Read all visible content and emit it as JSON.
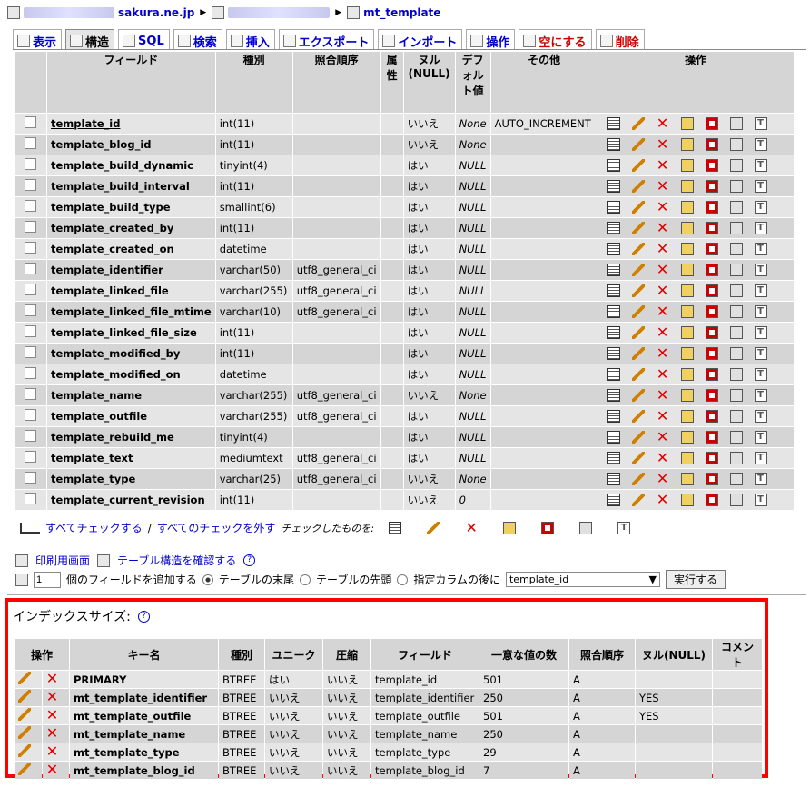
{
  "breadcrumb": {
    "server": "sakura.ne.jp",
    "table": "mt_template"
  },
  "tabs": [
    {
      "label": "表示",
      "active": false,
      "danger": false
    },
    {
      "label": "構造",
      "active": true,
      "danger": false
    },
    {
      "label": "SQL",
      "active": false,
      "danger": false
    },
    {
      "label": "検索",
      "active": false,
      "danger": false
    },
    {
      "label": "挿入",
      "active": false,
      "danger": false
    },
    {
      "label": "エクスポート",
      "active": false,
      "danger": false
    },
    {
      "label": "インポート",
      "active": false,
      "danger": false
    },
    {
      "label": "操作",
      "active": false,
      "danger": false
    },
    {
      "label": "空にする",
      "active": false,
      "danger": true
    },
    {
      "label": "削除",
      "active": false,
      "danger": true
    }
  ],
  "fields_table": {
    "headers": {
      "field": "フィールド",
      "type": "種別",
      "collation": "照合順序",
      "attr": "属性",
      "null": "ヌル (NULL)",
      "default": "デフォルト値",
      "extra": "その他",
      "action": "操作"
    },
    "rows": [
      {
        "name": "template_id",
        "type": "int(11)",
        "collation": "",
        "null": "いいえ",
        "default": "None",
        "extra": "AUTO_INCREMENT",
        "underline": true
      },
      {
        "name": "template_blog_id",
        "type": "int(11)",
        "collation": "",
        "null": "いいえ",
        "default": "None",
        "extra": ""
      },
      {
        "name": "template_build_dynamic",
        "type": "tinyint(4)",
        "collation": "",
        "null": "はい",
        "default": "NULL",
        "extra": ""
      },
      {
        "name": "template_build_interval",
        "type": "int(11)",
        "collation": "",
        "null": "はい",
        "default": "NULL",
        "extra": ""
      },
      {
        "name": "template_build_type",
        "type": "smallint(6)",
        "collation": "",
        "null": "はい",
        "default": "NULL",
        "extra": ""
      },
      {
        "name": "template_created_by",
        "type": "int(11)",
        "collation": "",
        "null": "はい",
        "default": "NULL",
        "extra": ""
      },
      {
        "name": "template_created_on",
        "type": "datetime",
        "collation": "",
        "null": "はい",
        "default": "NULL",
        "extra": ""
      },
      {
        "name": "template_identifier",
        "type": "varchar(50)",
        "collation": "utf8_general_ci",
        "null": "はい",
        "default": "NULL",
        "extra": ""
      },
      {
        "name": "template_linked_file",
        "type": "varchar(255)",
        "collation": "utf8_general_ci",
        "null": "はい",
        "default": "NULL",
        "extra": ""
      },
      {
        "name": "template_linked_file_mtime",
        "type": "varchar(10)",
        "collation": "utf8_general_ci",
        "null": "はい",
        "default": "NULL",
        "extra": ""
      },
      {
        "name": "template_linked_file_size",
        "type": "int(11)",
        "collation": "",
        "null": "はい",
        "default": "NULL",
        "extra": ""
      },
      {
        "name": "template_modified_by",
        "type": "int(11)",
        "collation": "",
        "null": "はい",
        "default": "NULL",
        "extra": ""
      },
      {
        "name": "template_modified_on",
        "type": "datetime",
        "collation": "",
        "null": "はい",
        "default": "NULL",
        "extra": ""
      },
      {
        "name": "template_name",
        "type": "varchar(255)",
        "collation": "utf8_general_ci",
        "null": "いいえ",
        "default": "None",
        "extra": ""
      },
      {
        "name": "template_outfile",
        "type": "varchar(255)",
        "collation": "utf8_general_ci",
        "null": "はい",
        "default": "NULL",
        "extra": ""
      },
      {
        "name": "template_rebuild_me",
        "type": "tinyint(4)",
        "collation": "",
        "null": "はい",
        "default": "NULL",
        "extra": ""
      },
      {
        "name": "template_text",
        "type": "mediumtext",
        "collation": "utf8_general_ci",
        "null": "はい",
        "default": "NULL",
        "extra": ""
      },
      {
        "name": "template_type",
        "type": "varchar(25)",
        "collation": "utf8_general_ci",
        "null": "いいえ",
        "default": "None",
        "extra": ""
      },
      {
        "name": "template_current_revision",
        "type": "int(11)",
        "collation": "",
        "null": "いいえ",
        "default": "0",
        "extra": ""
      }
    ]
  },
  "check_all": {
    "check": "すべてチェックする",
    "sep": " / ",
    "uncheck": "すべてのチェックを外す",
    "with_selected": "チェックしたものを:"
  },
  "print_view": "印刷用画面",
  "propose_structure": "テーブル構造を確認する",
  "add_fields": {
    "count": "1",
    "label": "個のフィールドを追加する",
    "opt_end": "テーブルの末尾",
    "opt_begin": "テーブルの先頭",
    "opt_after": "指定カラムの後に",
    "after_column": "template_id",
    "go": "実行する"
  },
  "indexes": {
    "title": "インデックスサイズ:",
    "headers": {
      "action": "操作",
      "key": "キー名",
      "type": "種別",
      "unique": "ユニーク",
      "packed": "圧縮",
      "field": "フィールド",
      "cardinality": "一意な値の数",
      "collation": "照合順序",
      "null": "ヌル(NULL)",
      "comment": "コメント"
    },
    "rows": [
      {
        "key": "PRIMARY",
        "type": "BTREE",
        "unique": "はい",
        "packed": "いいえ",
        "field": "template_id",
        "cardinality": "501",
        "collation": "A",
        "null": "",
        "comment": ""
      },
      {
        "key": "mt_template_identifier",
        "type": "BTREE",
        "unique": "いいえ",
        "packed": "いいえ",
        "field": "template_identifier",
        "cardinality": "250",
        "collation": "A",
        "null": "YES",
        "comment": ""
      },
      {
        "key": "mt_template_outfile",
        "type": "BTREE",
        "unique": "いいえ",
        "packed": "いいえ",
        "field": "template_outfile",
        "cardinality": "501",
        "collation": "A",
        "null": "YES",
        "comment": ""
      },
      {
        "key": "mt_template_name",
        "type": "BTREE",
        "unique": "いいえ",
        "packed": "いいえ",
        "field": "template_name",
        "cardinality": "250",
        "collation": "A",
        "null": "",
        "comment": ""
      },
      {
        "key": "mt_template_type",
        "type": "BTREE",
        "unique": "いいえ",
        "packed": "いいえ",
        "field": "template_type",
        "cardinality": "29",
        "collation": "A",
        "null": "",
        "comment": ""
      },
      {
        "key": "mt_template_blog_id",
        "type": "BTREE",
        "unique": "いいえ",
        "packed": "いいえ",
        "field": "template_blog_id",
        "cardinality": "7",
        "collation": "A",
        "null": "",
        "comment": ""
      }
    ]
  },
  "colors": {
    "highlight": "#ff0000",
    "link": "#0000cc",
    "row_light": "#e5e5e5",
    "row_dark": "#d5d5d5"
  }
}
